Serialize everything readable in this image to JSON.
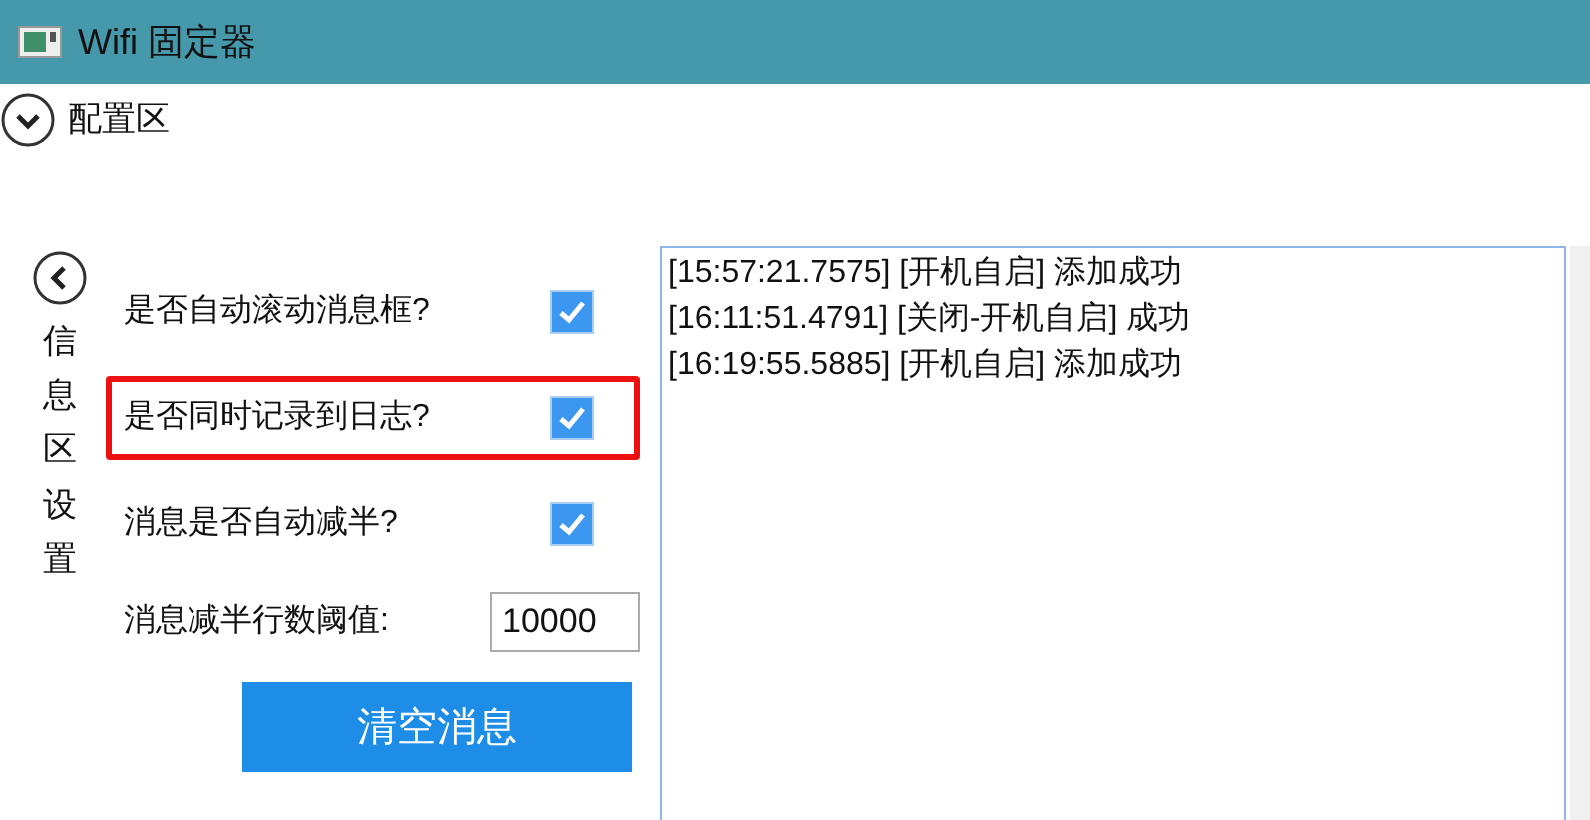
{
  "window": {
    "title": "Wifi 固定器"
  },
  "config_section": {
    "label": "配置区",
    "expanded": false
  },
  "info_settings": {
    "label": "信息区设置",
    "expanded": true
  },
  "options": [
    {
      "kind": "checkbox",
      "label": "是否自动滚动消息框?",
      "checked": true,
      "highlighted": false
    },
    {
      "kind": "checkbox",
      "label": "是否同时记录到日志?",
      "checked": true,
      "highlighted": true
    },
    {
      "kind": "checkbox",
      "label": "消息是否自动减半?",
      "checked": true,
      "highlighted": false
    },
    {
      "kind": "field",
      "label": "消息减半行数阈值:",
      "value": "10000"
    }
  ],
  "clear_button": "清空消息",
  "log": [
    "[15:57:21.7575] [开机自启] 添加成功",
    "[16:11:51.4791] [关闭-开机自启] 成功",
    "[16:19:55.5885] [开机自启] 添加成功"
  ]
}
